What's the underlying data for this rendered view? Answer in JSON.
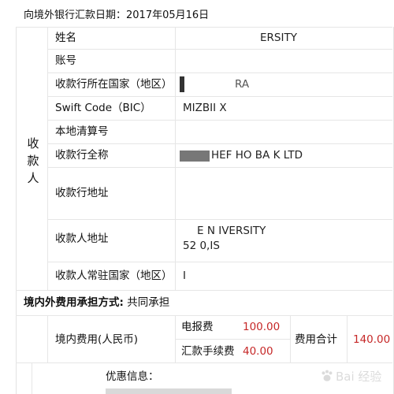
{
  "header": {
    "title": "向境外银行汇款日期：2017年05月16日"
  },
  "recipient_section": {
    "side_label": [
      "收",
      "款",
      "人"
    ],
    "rows": [
      {
        "label": "姓名",
        "value": "ERSITY"
      },
      {
        "label": "账号",
        "value": ""
      },
      {
        "label": "收款行所在国家（地区）",
        "value": "RA"
      },
      {
        "label": "Swift Code（BIC）",
        "value": "MIZBII X"
      },
      {
        "label": "本地清算号",
        "value": ""
      },
      {
        "label": "收款行全称",
        "value": "HEF HO BA K LTD"
      },
      {
        "label": "收款行地址",
        "value": ""
      },
      {
        "label": "收款人地址",
        "value_line1": "E N IVERSITY",
        "value_line2": "52 0,IS"
      },
      {
        "label": "收款人常驻国家（地区）",
        "value": "I"
      }
    ]
  },
  "fees": {
    "bearer_label": "境内外费用承担方式:",
    "bearer_value": "共同承担",
    "domestic_label": "境内费用(人民币)",
    "cable_fee_label": "电报费",
    "cable_fee_value": "100.00",
    "remit_fee_label": "汇款手续费",
    "remit_fee_value": "40.00",
    "total_label": "费用合计",
    "total_value": "140.00"
  },
  "discount": {
    "label": "优惠信息："
  },
  "watermark": {
    "text": "Bai 经验",
    "icon": "baidu-paw-icon",
    "color": "#9a9a9a"
  },
  "colors": {
    "accent_red": "#c62828",
    "grid": "#e6e6e6"
  }
}
